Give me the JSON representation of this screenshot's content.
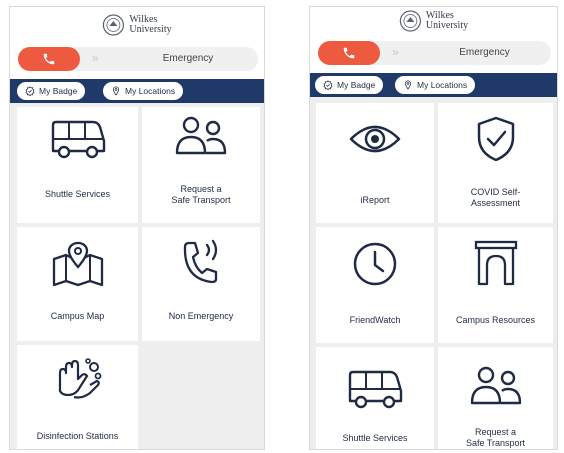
{
  "logo": {
    "line1": "Wilkes",
    "line2": "University"
  },
  "emergency": {
    "label": "Emergency",
    "arrows": "»"
  },
  "chips": {
    "badge": "My Badge",
    "locations": "My Locations"
  },
  "left_tiles": {
    "shuttle": "Shuttle Services",
    "request_line1": "Request a",
    "request_line2": "Safe Transport",
    "campus_map": "Campus Map",
    "non_emergency": "Non Emergency",
    "disinfection": "Disinfection Stations"
  },
  "right_tiles": {
    "ireport": "iReport",
    "covid_line1": "COVID Self-",
    "covid_line2": "Assessment",
    "friendwatch": "FriendWatch",
    "campus_resources": "Campus Resources",
    "shuttle": "Shuttle Services",
    "request_line1": "Request a",
    "request_line2": "Safe Transport"
  },
  "colors": {
    "accent": "#ee5a3f",
    "navy": "#1f3a68",
    "tile": "#ffffff",
    "background": "#eeeeee"
  },
  "icons": [
    "seal-icon",
    "phone-icon",
    "check-badge-icon",
    "pin-icon",
    "bus-icon",
    "people-icon",
    "map-icon",
    "phone-wave-icon",
    "hands-icon",
    "eye-icon",
    "shield-check-icon",
    "clock-icon",
    "arch-icon"
  ]
}
